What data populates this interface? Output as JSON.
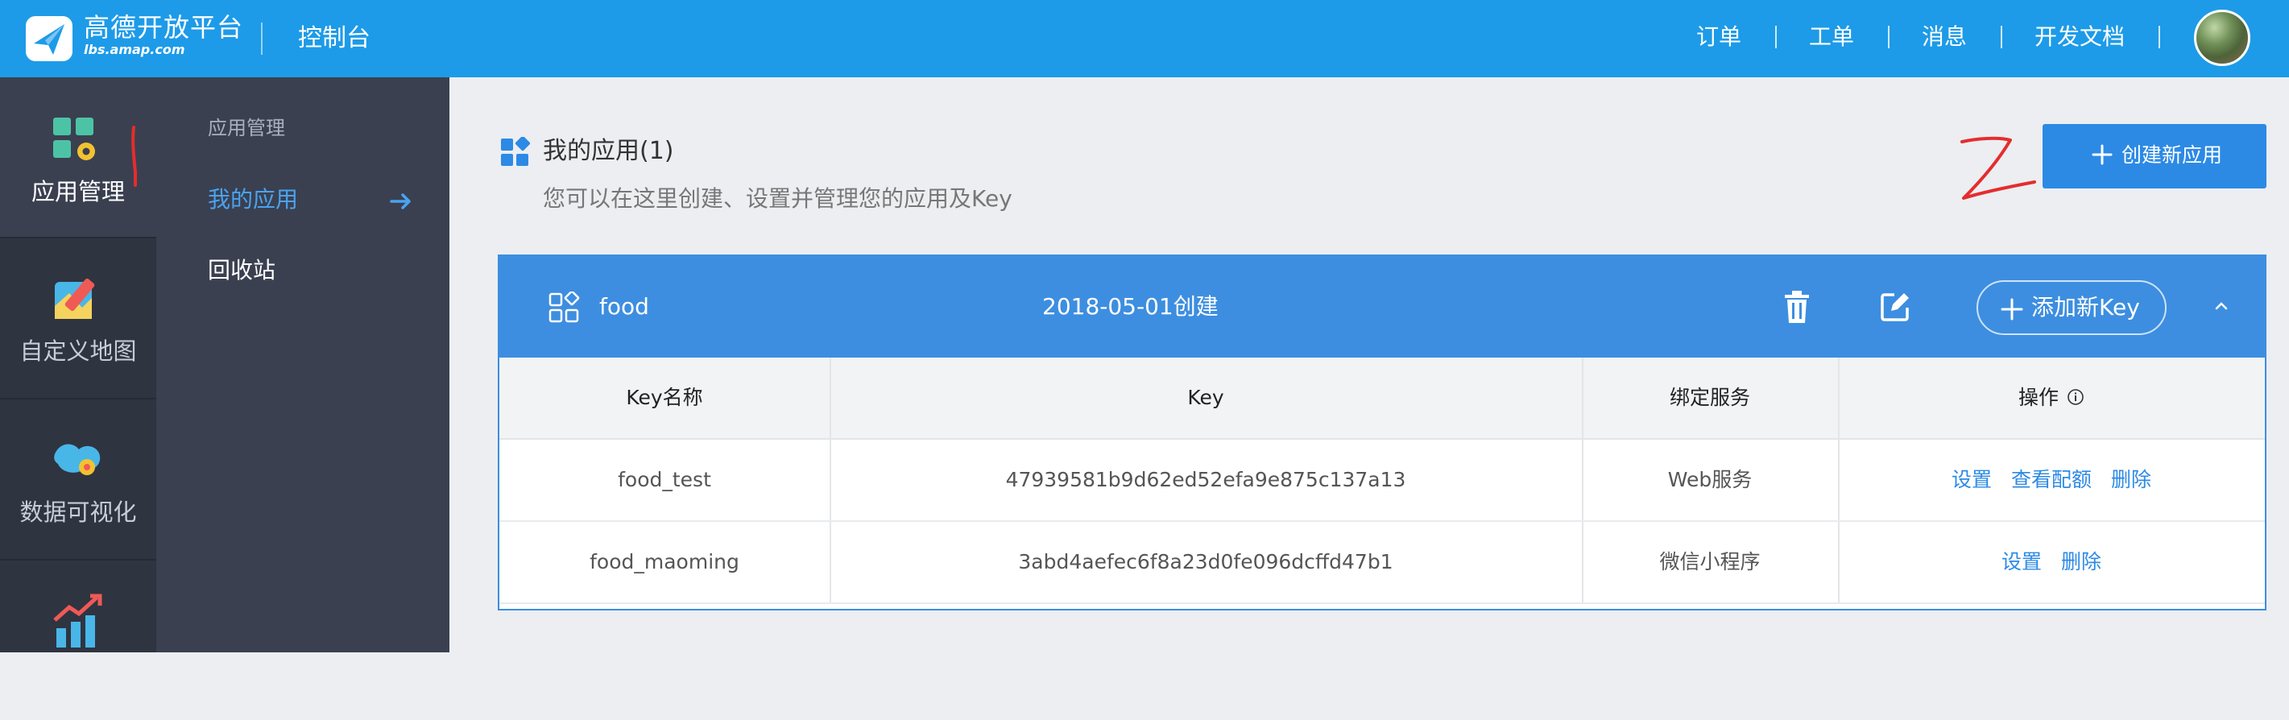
{
  "header": {
    "logo_cn": "高德开放平台",
    "logo_en": "lbs.amap.com",
    "console_title": "控制台",
    "nav": [
      "订单",
      "工单",
      "消息",
      "开发文档"
    ]
  },
  "leftnav": {
    "items": [
      {
        "label": "应用管理",
        "icon": "app-manage-icon"
      },
      {
        "label": "自定义地图",
        "icon": "custom-map-icon"
      },
      {
        "label": "数据可视化",
        "icon": "data-visual-icon"
      },
      {
        "label": "",
        "icon": "stats-chart-icon"
      }
    ]
  },
  "subnav": {
    "title": "应用管理",
    "items": [
      "我的应用",
      "回收站"
    ]
  },
  "annotations": {
    "mark_one": "1",
    "mark_two": "2"
  },
  "page": {
    "title": "我的应用(1)",
    "subtitle": "您可以在这里创建、设置并管理您的应用及Key",
    "create_button": "创建新应用"
  },
  "app": {
    "name": "food",
    "created": "2018-05-01创建",
    "add_key_button": "添加新Key"
  },
  "table": {
    "headers": [
      "Key名称",
      "Key",
      "绑定服务",
      "操作"
    ],
    "rows": [
      {
        "name": "food_test",
        "key": "47939581b9d62ed52efa9e875c137a13",
        "service": "Web服务",
        "actions": [
          "设置",
          "查看配额",
          "删除"
        ]
      },
      {
        "name": "food_maoming",
        "key": "3abd4aefec6f8a23d0fe096dcffd47b1",
        "service": "微信小程序",
        "actions": [
          "设置",
          "删除"
        ]
      }
    ]
  },
  "colors": {
    "header_bg": "#1d9be8",
    "leftnav_bg": "#2f3441",
    "subnav_bg": "#3a4050",
    "accent": "#2c8ae5",
    "card_head": "#3d8ee0",
    "annotation_red": "#e52d2d"
  }
}
